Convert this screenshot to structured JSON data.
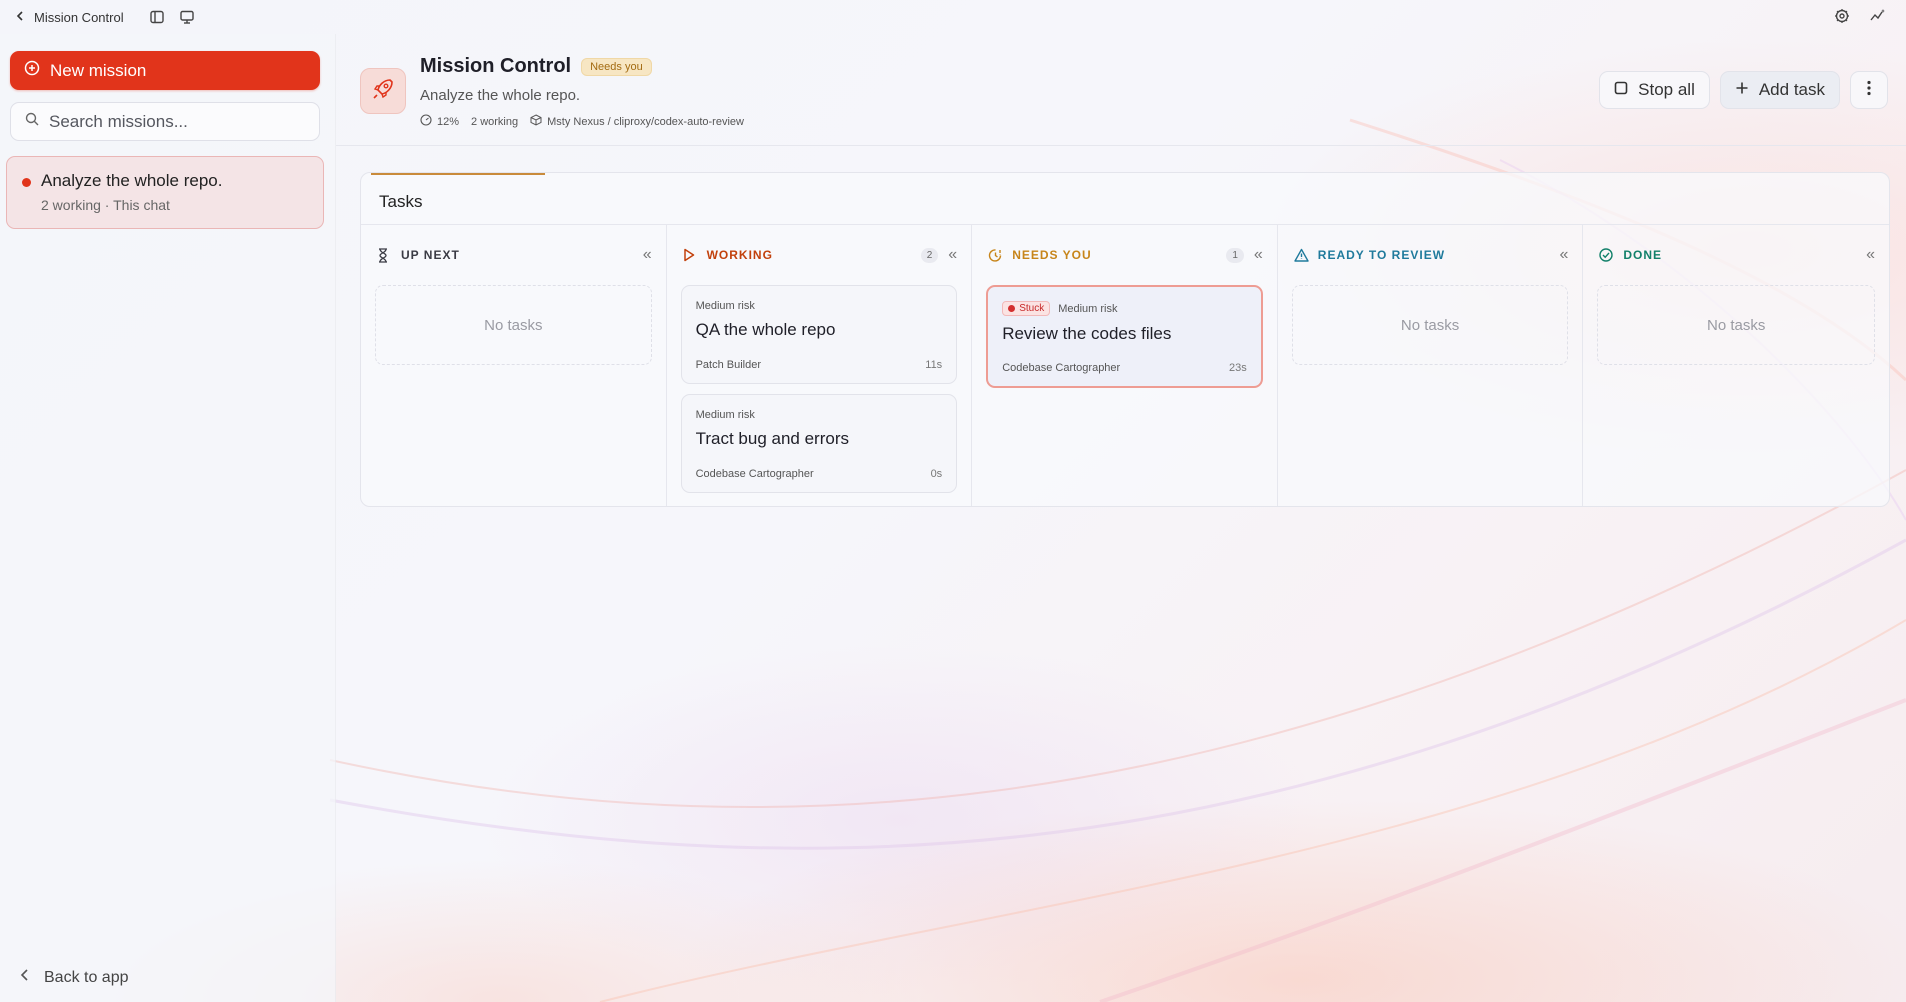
{
  "topbar": {
    "back_label": "Mission Control"
  },
  "sidebar": {
    "new_mission_label": "New mission",
    "search_placeholder": "Search missions...",
    "missions": [
      {
        "title": "Analyze the whole repo.",
        "subtitle": "2 working · This chat",
        "status_color": "#e1341b"
      }
    ],
    "back_to_app_label": "Back to app"
  },
  "header": {
    "title": "Mission Control",
    "status_badge": "Needs you",
    "description": "Analyze the whole repo.",
    "progress": "12%",
    "working": "2 working",
    "workspace": "Msty Nexus / cliproxy/codex-auto-review",
    "stop_all_label": "Stop all",
    "add_task_label": "Add task"
  },
  "tasks": {
    "title": "Tasks",
    "progress_fraction": 0.12,
    "empty_label": "No tasks",
    "columns": [
      {
        "label": "UP NEXT",
        "count": "",
        "color": "#3a3b44",
        "icon": "hourglass-icon"
      },
      {
        "label": "WORKING",
        "count": "2",
        "color": "#c2410c",
        "icon": "play-icon"
      },
      {
        "label": "NEEDS YOU",
        "count": "1",
        "color": "#c7851a",
        "icon": "clock-alert-icon"
      },
      {
        "label": "READY TO REVIEW",
        "count": "",
        "color": "#1f7a9c",
        "icon": "warning-triangle-icon"
      },
      {
        "label": "DONE",
        "count": "",
        "color": "#12806a",
        "icon": "check-circle-icon"
      }
    ],
    "working_cards": [
      {
        "risk": "Medium risk",
        "title": "QA the whole repo",
        "agent": "Patch Builder",
        "time": "11s"
      },
      {
        "risk": "Medium risk",
        "title": "Tract bug and errors",
        "agent": "Codebase Cartographer",
        "time": "0s"
      }
    ],
    "needs_cards": [
      {
        "badge": "Stuck",
        "risk": "Medium risk",
        "title": "Review the codes files",
        "agent": "Codebase Cartographer",
        "time": "23s"
      }
    ]
  },
  "colors": {
    "accent": "#e1341b",
    "needs_badge_bg": "#f7e6c3",
    "stuck_border": "#ee9c93"
  }
}
